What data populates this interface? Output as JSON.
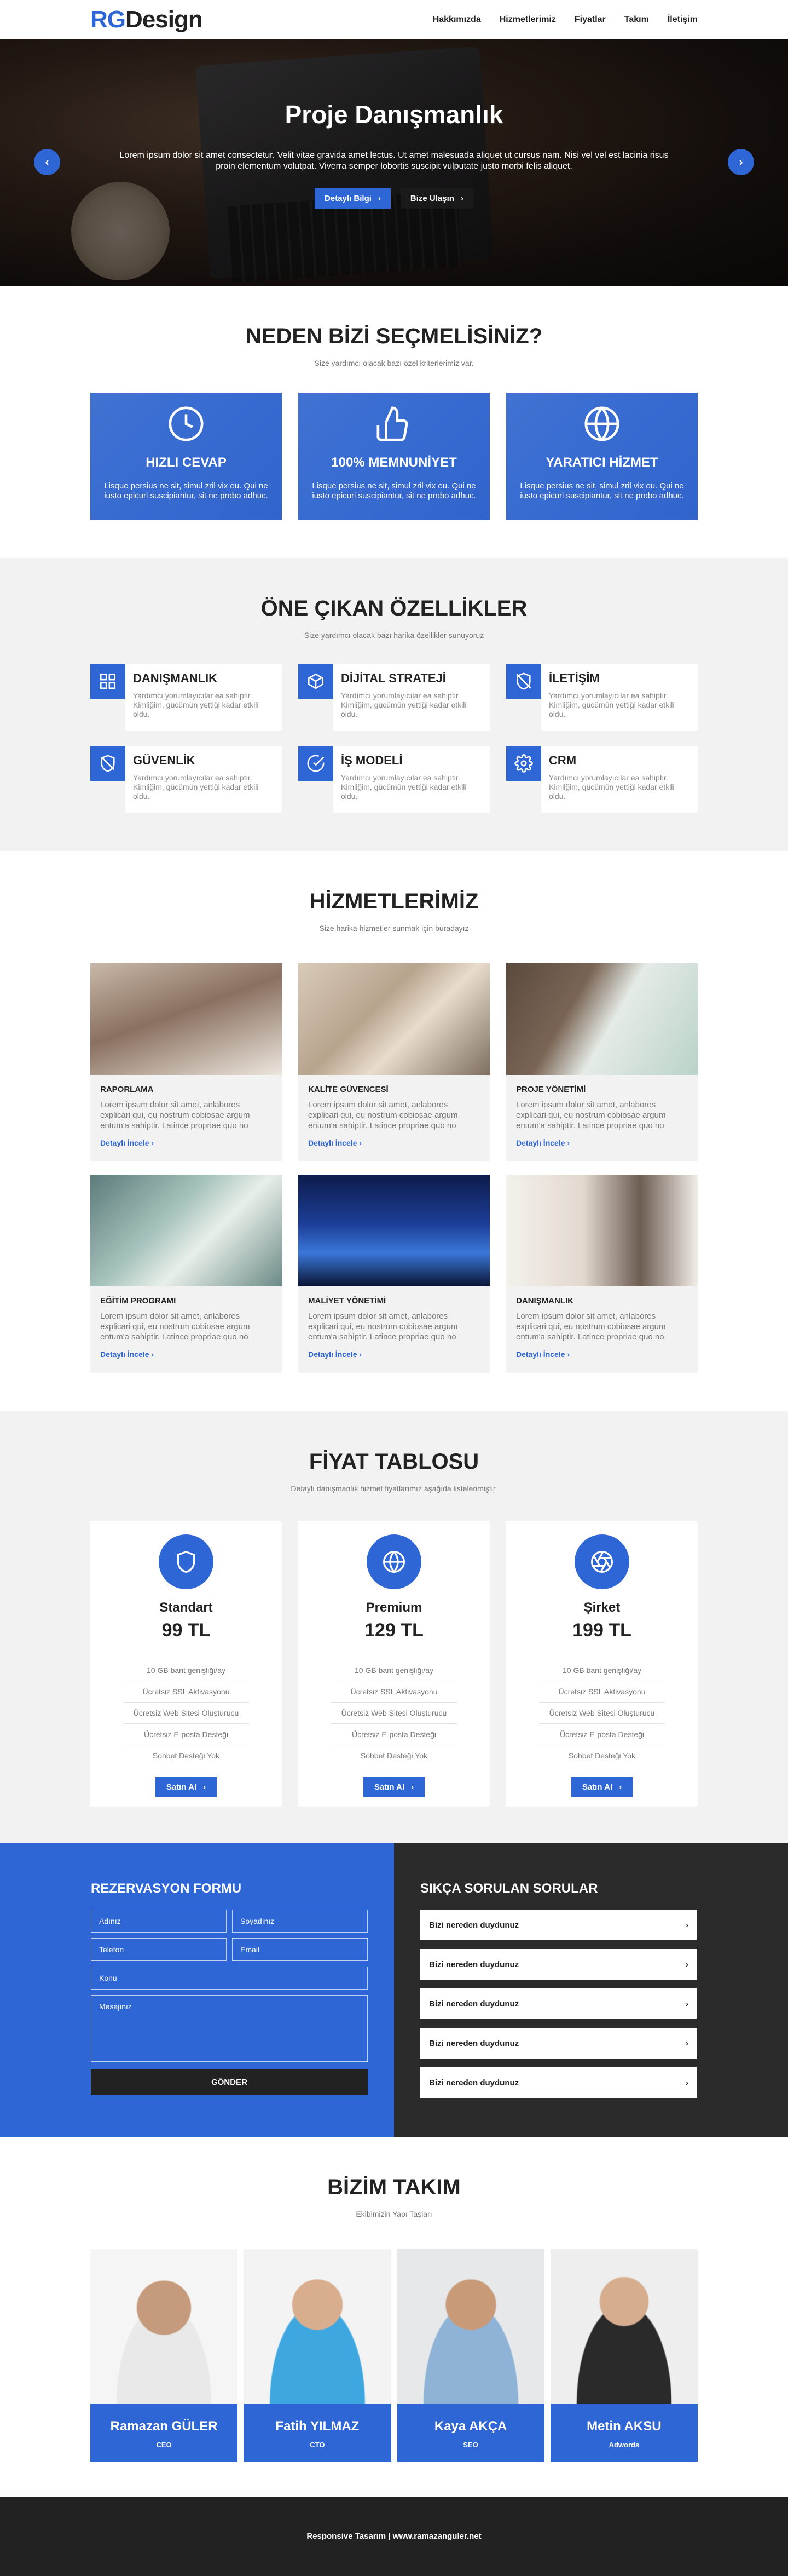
{
  "header": {
    "logo_rg": "RG",
    "logo_rest": "Design",
    "nav": [
      "Hakkımızda",
      "Hizmetlerimiz",
      "Fiyatlar",
      "Takım",
      "İletişim"
    ]
  },
  "hero": {
    "title": "Proje Danışmanlık",
    "text": "Lorem ipsum dolor sit amet consectetur. Velit vitae gravida amet lectus. Ut amet malesuada aliquet ut cursus nam. Nisi vel vel est lacinia risus proin elementum volutpat. Viverra semper lobortis suscipit vulputate justo morbi felis aliquet.",
    "btn_primary": "Detaylı Bilgi",
    "btn_secondary": "Bize Ulaşın"
  },
  "why": {
    "title": "NEDEN BİZİ SEÇMELİSİNİZ?",
    "subtitle": "Size yardımcı olacak bazı özel kriterlerimiz var.",
    "cards": [
      {
        "icon": "clock-icon",
        "title": "HIZLI CEVAP",
        "text": "Lisque persius ne sit, simul zril vix eu. Qui ne iusto epicuri suscipiantur, sit ne probo adhuc."
      },
      {
        "icon": "thumbs-up-icon",
        "title": "100% MEMNUNİYET",
        "text": "Lisque persius ne sit, simul zril vix eu. Qui ne iusto epicuri suscipiantur, sit ne probo adhuc."
      },
      {
        "icon": "globe-icon",
        "title": "YARATICI HİZMET",
        "text": "Lisque persius ne sit, simul zril vix eu. Qui ne iusto epicuri suscipiantur, sit ne probo adhuc."
      }
    ]
  },
  "features": {
    "title": "ÖNE ÇIKAN ÖZELLİKLER",
    "subtitle": "Size yardımcı olacak bazı harika özellikler sunuyoruz",
    "items": [
      {
        "icon": "grid-icon",
        "title": "DANIŞMANLIK",
        "text": "Yardımcı yorumlayıcılar ea sahiptir. Kimliğim, gücümün yettiği kadar etkili oldu."
      },
      {
        "icon": "box-icon",
        "title": "DİJİTAL STRATEJİ",
        "text": "Yardımcı yorumlayıcılar ea sahiptir. Kimliğim, gücümün yettiği kadar etkili oldu."
      },
      {
        "icon": "phone-icon",
        "title": "İLETİŞİM",
        "text": "Yardımcı yorumlayıcılar ea sahiptir. Kimliğim, gücümün yettiği kadar etkili oldu."
      },
      {
        "icon": "shield-off-icon",
        "title": "GÜVENLİK",
        "text": "Yardımcı yorumlayıcılar ea sahiptir. Kimliğim, gücümün yettiği kadar etkili oldu."
      },
      {
        "icon": "check-circle-icon",
        "title": "İŞ MODELİ",
        "text": "Yardımcı yorumlayıcılar ea sahiptir. Kimliğim, gücümün yettiği kadar etkili oldu."
      },
      {
        "icon": "gear-icon",
        "title": "CRM",
        "text": "Yardımcı yorumlayıcılar ea sahiptir. Kimliğim, gücümün yettiği kadar etkili oldu."
      }
    ]
  },
  "services": {
    "title": "HİZMETLERİMİZ",
    "subtitle": "Size harika hizmetler sunmak için buradayız",
    "more_label": "Detaylı İncele",
    "items": [
      {
        "title": "RAPORLAMA",
        "text": "Lorem ipsum dolor sit amet, anlabores explicari qui, eu nostrum cobiosae argum entum'a sahiptir. Latince propriae quo no"
      },
      {
        "title": "KALİTE GÜVENCESİ",
        "text": "Lorem ipsum dolor sit amet, anlabores explicari qui, eu nostrum cobiosae argum entum'a sahiptir. Latince propriae quo no"
      },
      {
        "title": "PROJE YÖNETİMİ",
        "text": "Lorem ipsum dolor sit amet, anlabores explicari qui, eu nostrum cobiosae argum entum'a sahiptir. Latince propriae quo no"
      },
      {
        "title": "EĞİTİM PROGRAMI",
        "text": "Lorem ipsum dolor sit amet, anlabores explicari qui, eu nostrum cobiosae argum entum'a sahiptir. Latince propriae quo no"
      },
      {
        "title": "MALİYET YÖNETİMİ",
        "text": "Lorem ipsum dolor sit amet, anlabores explicari qui, eu nostrum cobiosae argum entum'a sahiptir. Latince propriae quo no"
      },
      {
        "title": "DANIŞMANLIK",
        "text": "Lorem ipsum dolor sit amet, anlabores explicari qui, eu nostrum cobiosae argum entum'a sahiptir. Latince propriae quo no"
      }
    ]
  },
  "pricing": {
    "title": "FİYAT TABLOSU",
    "subtitle": "Detaylı danışmanlık hizmet fiyatlarımız aşağıda listelenmiştir.",
    "buy_label": "Satın Al",
    "plans": [
      {
        "icon": "shield-icon",
        "name": "Standart",
        "price": "99 TL",
        "features": [
          "10 GB bant genişliği/ay",
          "Ücretsiz SSL Aktivasyonu",
          "Ücretsiz Web Sitesi Oluşturucu",
          "Ücretsiz E-posta Desteği",
          "Sohbet Desteği Yok"
        ]
      },
      {
        "icon": "globe-icon",
        "name": "Premium",
        "price": "129 TL",
        "features": [
          "10 GB bant genişliği/ay",
          "Ücretsiz SSL Aktivasyonu",
          "Ücretsiz Web Sitesi Oluşturucu",
          "Ücretsiz E-posta Desteği",
          "Sohbet Desteği Yok"
        ]
      },
      {
        "icon": "aperture-icon",
        "name": "Şirket",
        "price": "199 TL",
        "features": [
          "10 GB bant genişliği/ay",
          "Ücretsiz SSL Aktivasyonu",
          "Ücretsiz Web Sitesi Oluşturucu",
          "Ücretsiz E-posta Desteği",
          "Sohbet Desteği Yok"
        ]
      }
    ]
  },
  "form": {
    "title": "REZERVASYON FORMU",
    "first_name": "Adınız",
    "last_name": "Soyadınız",
    "phone": "Telefon",
    "email": "Email",
    "subject": "Konu",
    "message": "Mesajınız",
    "submit": "GÖNDER"
  },
  "faq": {
    "title": "SIKÇA SORULAN SORULAR",
    "items": [
      "Bizi nereden duydunuz",
      "Bizi nereden duydunuz",
      "Bizi nereden duydunuz",
      "Bizi nereden duydunuz",
      "Bizi nereden duydunuz"
    ]
  },
  "team": {
    "title": "BİZİM TAKIM",
    "subtitle": "Ekibimizin Yapı Taşları",
    "members": [
      {
        "name": "Ramazan GÜLER",
        "role": "CEO"
      },
      {
        "name": "Fatih YILMAZ",
        "role": "CTO"
      },
      {
        "name": "Kaya AKÇA",
        "role": "SEO"
      },
      {
        "name": "Metin AKSU",
        "role": "Adwords"
      }
    ]
  },
  "footer": {
    "text": "Responsive Tasarım | www.ramazanguler.net"
  },
  "colors": {
    "accent": "#2f66d6",
    "dark": "#222222"
  }
}
